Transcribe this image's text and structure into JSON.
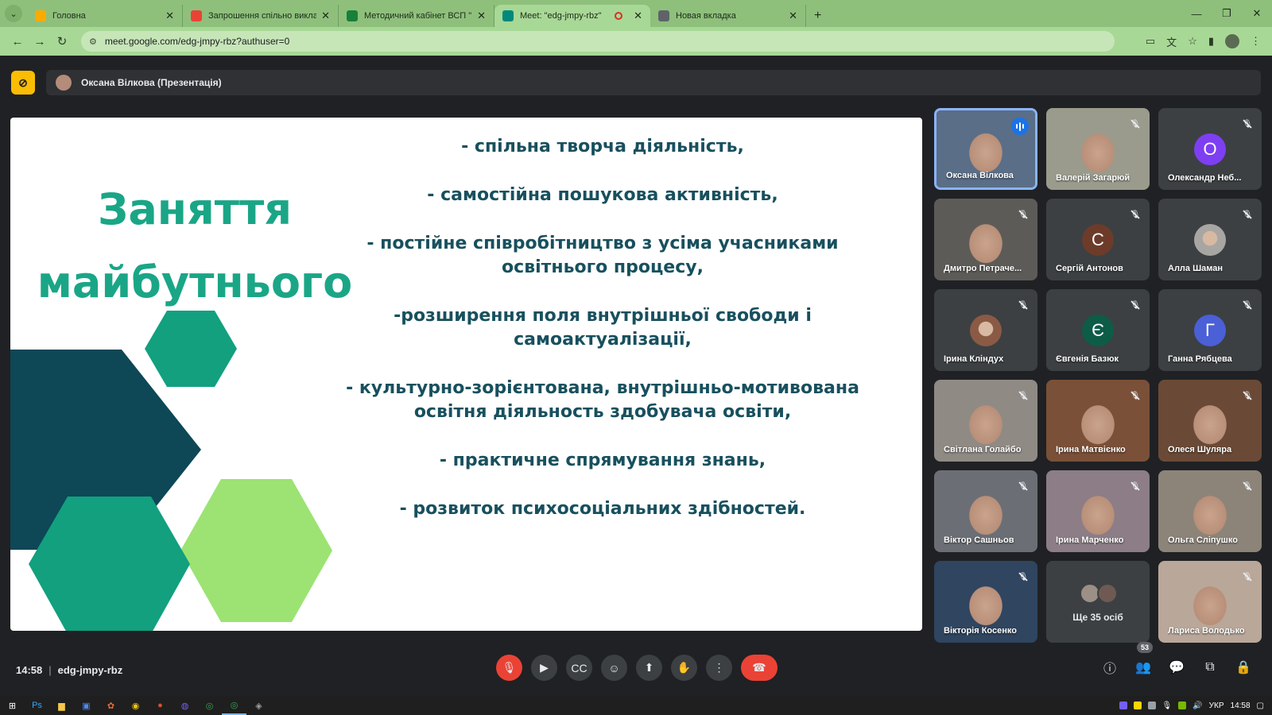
{
  "browser": {
    "tabs": [
      {
        "title": "Головна",
        "favicon_color": "#f9ab00"
      },
      {
        "title": "Запрошення спільно виклад",
        "favicon_color": "#ea4335"
      },
      {
        "title": "Методичний кабінет ВСП \"ГА",
        "favicon_color": "#188038"
      },
      {
        "title": "Meet: \"edg-jmpy-rbz\"",
        "favicon_color": "#00897b",
        "active": true,
        "recording": true
      },
      {
        "title": "Новая вкладка",
        "favicon_color": "#5f6368"
      }
    ],
    "url": "meet.google.com/edg-jmpy-rbz?authuser=0"
  },
  "presentation": {
    "presenter_label": "Оксана Вілкова (Презентація)"
  },
  "slide": {
    "title_line1": "Заняття",
    "title_line2": "майбутнього",
    "bullets": [
      "- спільна творча діяльність,",
      "- самостійна пошукова активність,",
      "- постійне співробітництво з усіма учасниками освітнього процесу,",
      "-розширення поля внутрішньої свободи і самоактуалізації,",
      "- культурно-зорієнтована, внутрішньо-мотивована освітня діяльность здобувача освіти,",
      "- практичне спрямування знань,",
      "- розвиток психосоціальних здібностей."
    ],
    "colors": {
      "title": "#1aa686",
      "text": "#18505e",
      "hex_dark": "#0e4756",
      "hex_teal": "#12a07f",
      "hex_green": "#9ce373"
    }
  },
  "participants": [
    {
      "name": "Оксана Вілкова",
      "kind": "video",
      "speaking": true,
      "muted": false,
      "bg": "#5a6e88"
    },
    {
      "name": "Валерій Загарюй",
      "kind": "video",
      "muted": true,
      "bg": "#9a9b8c"
    },
    {
      "name": "Олександр Неб...",
      "kind": "letter",
      "letter": "О",
      "color": "#7e3ff2",
      "muted": true
    },
    {
      "name": "Дмитро Петраче...",
      "kind": "video",
      "muted": true,
      "bg": "#5d5b58"
    },
    {
      "name": "Сергій Антонов",
      "kind": "letter",
      "letter": "С",
      "color": "#6d3b2a",
      "muted": true
    },
    {
      "name": "Алла Шаман",
      "kind": "photo",
      "color": "#a8a6a3",
      "muted": true
    },
    {
      "name": "Ірина Кліндух",
      "kind": "photo",
      "color": "#8a5a45",
      "muted": true
    },
    {
      "name": "Євгенія Базюк",
      "kind": "letter",
      "letter": "Є",
      "color": "#0d5c47",
      "muted": true
    },
    {
      "name": "Ганна Рябцева",
      "kind": "letter",
      "letter": "Г",
      "color": "#4b5fd6",
      "muted": true
    },
    {
      "name": "Світлана Голайбо",
      "kind": "video",
      "muted": true,
      "bg": "#8f8a84"
    },
    {
      "name": "Ірина Матвієнко",
      "kind": "video",
      "muted": true,
      "bg": "#7a5038"
    },
    {
      "name": "Олеся Шуляра",
      "kind": "video",
      "muted": true,
      "bg": "#6a4a36"
    },
    {
      "name": "Віктор Сашньов",
      "kind": "video",
      "muted": true,
      "bg": "#6b6f75"
    },
    {
      "name": "Ірина Марченко",
      "kind": "video",
      "muted": true,
      "bg": "#8c7d86"
    },
    {
      "name": "Ольга Сліпушко",
      "kind": "video",
      "muted": true,
      "bg": "#8c8479"
    },
    {
      "name": "Вікторія Косенко",
      "kind": "video",
      "muted": true,
      "bg": "#2f4560"
    },
    {
      "name": "Ще 35 осіб",
      "kind": "more"
    },
    {
      "name": "Лариса Володько",
      "kind": "video",
      "muted": true,
      "bg": "#b9a79a"
    }
  ],
  "meeting": {
    "time": "14:58",
    "code": "edg-jmpy-rbz",
    "participant_count": "53"
  },
  "taskbar": {
    "language": "УКР",
    "clock": "14:58"
  }
}
